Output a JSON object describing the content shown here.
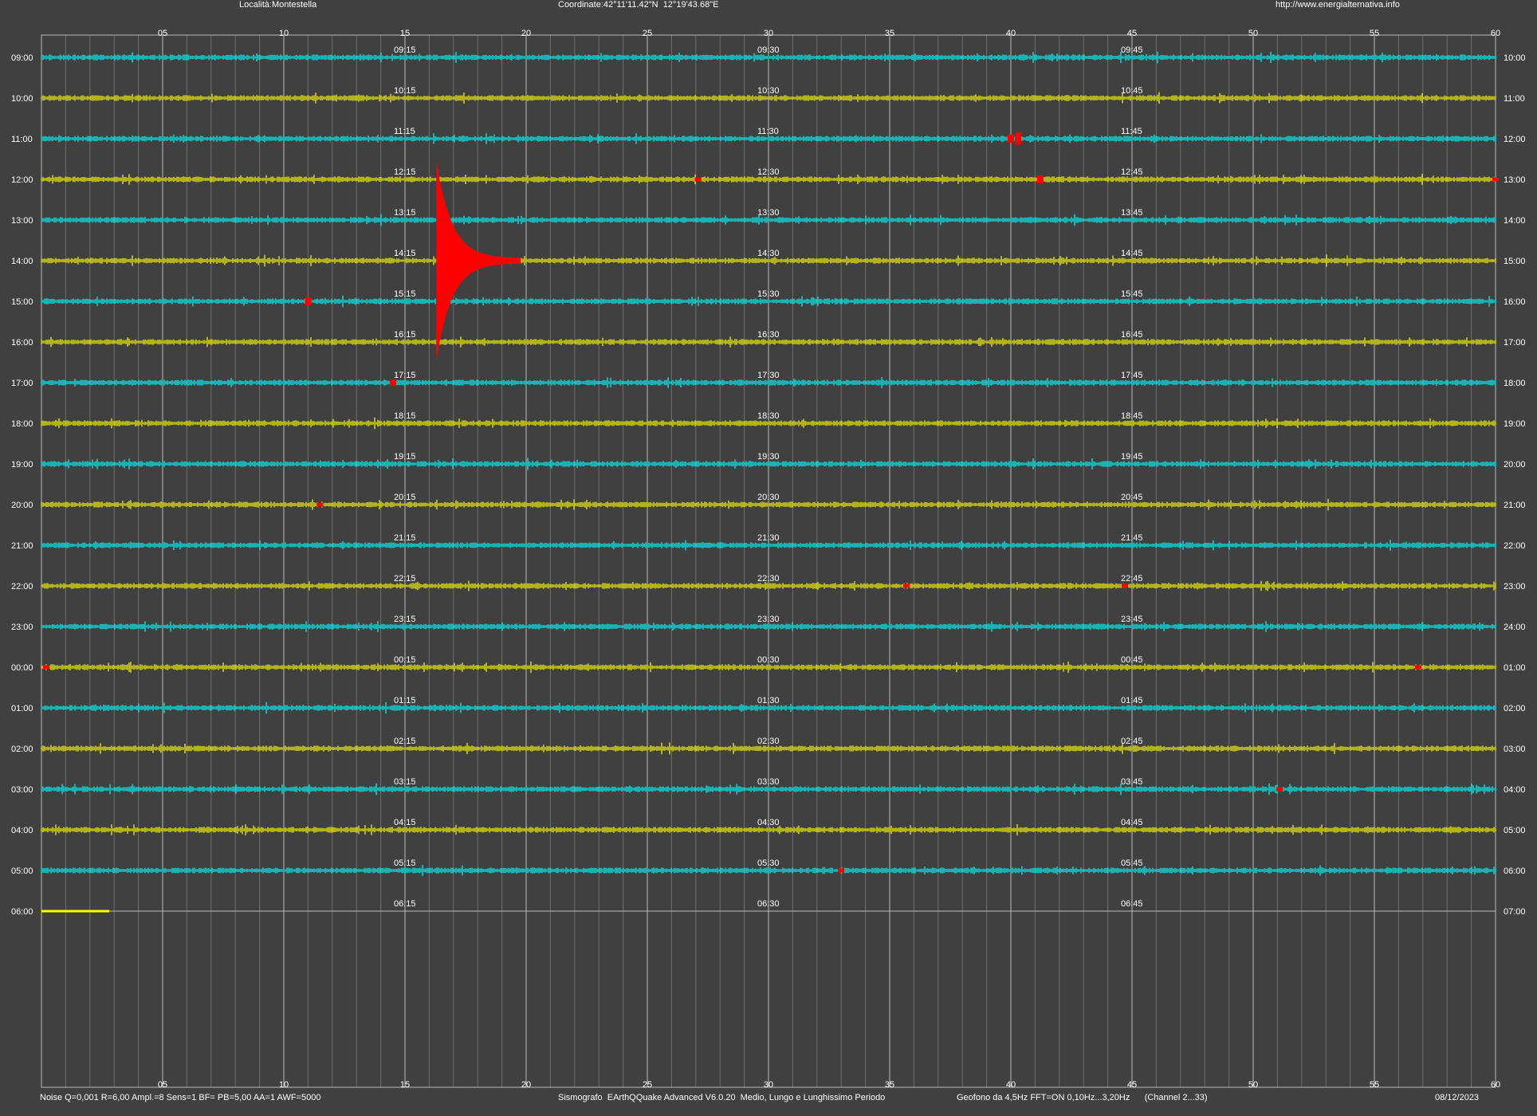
{
  "header": {
    "location": "Località:Montestella",
    "coordinates": "Coordinate:42°11'11.42\"N  12°19'43.68\"E",
    "url": "http://www.energialternativa.info"
  },
  "footer": {
    "settings": "Noise Q=0,001 R=6,00 Ampl.=8 Sens=1 BF= PB=5,00 AA=1 AWF=5000",
    "software": "Sismografo  EArthQQuake Advanced V6.0.20  Medio, Lungo e Lunghissimo Periodo",
    "sensor": "Geofono da 4,5Hz FFT=ON 0,10Hz...3,20Hz      (Channel 2...33)",
    "date": "08/12/2023"
  },
  "colors": {
    "background": "#404040",
    "grid_major": "#bdbdbd",
    "grid_minor": "#6e6e6e",
    "trace_a": "#00ffff",
    "trace_b": "#ffff00",
    "event": "#ff0000",
    "text": "#ffffff"
  },
  "chart_data": {
    "type": "line",
    "description_of_axes": "",
    "x_ticks": [
      "05",
      "10",
      "15",
      "20",
      "25",
      "30",
      "35",
      "40",
      "45",
      "50",
      "55",
      "60"
    ],
    "xlim": [
      0,
      60
    ],
    "rows": [
      {
        "left": "09:00",
        "right": "10:00",
        "q15": "09:15",
        "q30": "09:30",
        "q45": "09:45"
      },
      {
        "left": "10:00",
        "right": "11:00",
        "q15": "10:15",
        "q30": "10:30",
        "q45": "10:45"
      },
      {
        "left": "11:00",
        "right": "12:00",
        "q15": "11:15",
        "q30": "11:30",
        "q45": "11:45"
      },
      {
        "left": "12:00",
        "right": "13:00",
        "q15": "12:15",
        "q30": "12:30",
        "q45": "12:45"
      },
      {
        "left": "13:00",
        "right": "14:00",
        "q15": "13:15",
        "q30": "13:30",
        "q45": "13:45"
      },
      {
        "left": "14:00",
        "right": "15:00",
        "q15": "14:15",
        "q30": "14:30",
        "q45": "14:45"
      },
      {
        "left": "15:00",
        "right": "16:00",
        "q15": "15:15",
        "q30": "15:30",
        "q45": "15:45"
      },
      {
        "left": "16:00",
        "right": "17:00",
        "q15": "16:15",
        "q30": "16:30",
        "q45": "16:45"
      },
      {
        "left": "17:00",
        "right": "18:00",
        "q15": "17:15",
        "q30": "17:30",
        "q45": "17:45"
      },
      {
        "left": "18:00",
        "right": "19:00",
        "q15": "18:15",
        "q30": "18:30",
        "q45": "18:45"
      },
      {
        "left": "19:00",
        "right": "20:00",
        "q15": "19:15",
        "q30": "19:30",
        "q45": "19:45"
      },
      {
        "left": "20:00",
        "right": "21:00",
        "q15": "20:15",
        "q30": "20:30",
        "q45": "20:45"
      },
      {
        "left": "21:00",
        "right": "22:00",
        "q15": "21:15",
        "q30": "21:30",
        "q45": "21:45"
      },
      {
        "left": "22:00",
        "right": "23:00",
        "q15": "22:15",
        "q30": "22:30",
        "q45": "22:45"
      },
      {
        "left": "23:00",
        "right": "24:00",
        "q15": "23:15",
        "q30": "23:30",
        "q45": "23:45"
      },
      {
        "left": "00:00",
        "right": "01:00",
        "q15": "00:15",
        "q30": "00:30",
        "q45": "00:45"
      },
      {
        "left": "01:00",
        "right": "02:00",
        "q15": "01:15",
        "q30": "01:30",
        "q45": "01:45"
      },
      {
        "left": "02:00",
        "right": "03:00",
        "q15": "02:15",
        "q30": "02:30",
        "q45": "02:45"
      },
      {
        "left": "03:00",
        "right": "04:00",
        "q15": "03:15",
        "q30": "03:30",
        "q45": "03:45"
      },
      {
        "left": "04:00",
        "right": "05:00",
        "q15": "04:15",
        "q30": "04:30",
        "q45": "04:45"
      },
      {
        "left": "05:00",
        "right": "06:00",
        "q15": "05:15",
        "q30": "05:30",
        "q45": "05:45"
      },
      {
        "left": "06:00",
        "right": "07:00",
        "q15": "06:15",
        "q30": "06:30",
        "q45": "06:45"
      }
    ],
    "events": [
      {
        "row": 2,
        "minute": 40.0,
        "amp": 0.2
      },
      {
        "row": 2,
        "minute": 40.3,
        "amp": 0.3
      },
      {
        "row": 3,
        "minute": 27.1,
        "amp": 0.1
      },
      {
        "row": 3,
        "minute": 41.2,
        "amp": 0.2
      },
      {
        "row": 3,
        "minute": 60.0,
        "amp": 0.1
      },
      {
        "row": 5,
        "minute": 16.3,
        "amp": 2.4,
        "decay_to": 19.8
      },
      {
        "row": 6,
        "minute": 11.0,
        "amp": 0.2
      },
      {
        "row": 8,
        "minute": 14.5,
        "amp": 0.15
      },
      {
        "row": 11,
        "minute": 11.5,
        "amp": 0.1
      },
      {
        "row": 13,
        "minute": 35.7,
        "amp": 0.1
      },
      {
        "row": 13,
        "minute": 44.7,
        "amp": 0.1
      },
      {
        "row": 15,
        "minute": 0.2,
        "amp": 0.1
      },
      {
        "row": 15,
        "minute": 56.8,
        "amp": 0.1
      },
      {
        "row": 18,
        "minute": 51.1,
        "amp": 0.1
      },
      {
        "row": 20,
        "minute": 33.0,
        "amp": 0.1
      }
    ],
    "last_row_end_minute": 2.8
  }
}
